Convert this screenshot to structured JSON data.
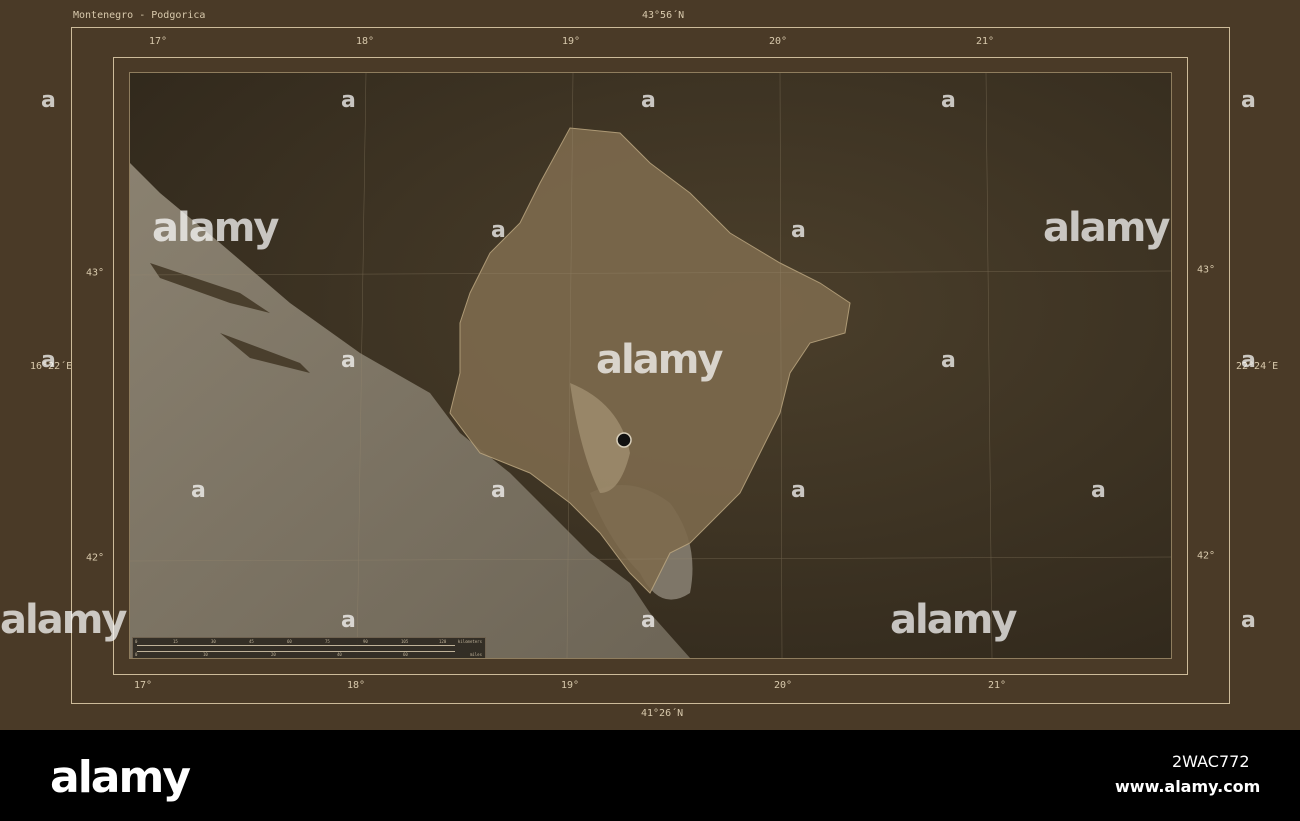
{
  "map_title": "Montenegro - Podgorica",
  "top_lat": "43°56´N",
  "bottom_lat": "41°26´N",
  "left_lon": "16°22´E",
  "right_lon": "22°24´E",
  "top_lon_ticks": [
    "17°",
    "18°",
    "19°",
    "20°",
    "21°"
  ],
  "bottom_lon_ticks": [
    "17°",
    "18°",
    "19°",
    "20°",
    "21°"
  ],
  "left_lat_ticks": [
    "43°",
    "42°"
  ],
  "right_lat_ticks": [
    "43°",
    "42°"
  ],
  "scalebar": {
    "km_label": "kilometers",
    "mi_label": "miles",
    "km_ticks": [
      "0",
      "15",
      "30",
      "45",
      "60",
      "75",
      "90",
      "105",
      "120"
    ],
    "mi_ticks": [
      "0",
      "10",
      "20",
      "40",
      "60"
    ]
  },
  "watermark": {
    "logo_text": "alamy",
    "small_mark": "a"
  },
  "footer": {
    "logo": "alamy",
    "image_id": "2WAC772",
    "url": "www.alamy.com"
  },
  "colors": {
    "frame": "#4a3a27",
    "sea": "#7a7263",
    "land_dark": "#3a3122",
    "highlight": "#7d6a4d",
    "marker": "#111111"
  },
  "icons": [
    "capital-marker-icon"
  ]
}
